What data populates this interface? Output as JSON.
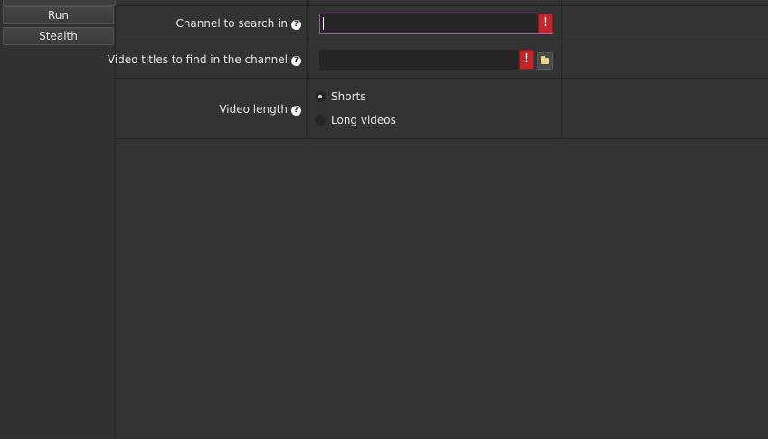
{
  "sidebar": {
    "buttons": [
      {
        "label": "Run"
      },
      {
        "label": "Stealth"
      }
    ]
  },
  "form": {
    "channel": {
      "label": "Channel to search in",
      "value": "",
      "warning": "!"
    },
    "titles": {
      "label": "Video titles to find in the channel",
      "value": "",
      "warning": "!"
    },
    "length": {
      "label": "Video length",
      "options": [
        {
          "label": "Shorts",
          "selected": true
        },
        {
          "label": "Long videos",
          "selected": false
        }
      ]
    },
    "help_glyph": "?"
  },
  "colors": {
    "background": "#333333",
    "field_focus_border": "#9a5aa8",
    "warning": "#c0262c"
  }
}
